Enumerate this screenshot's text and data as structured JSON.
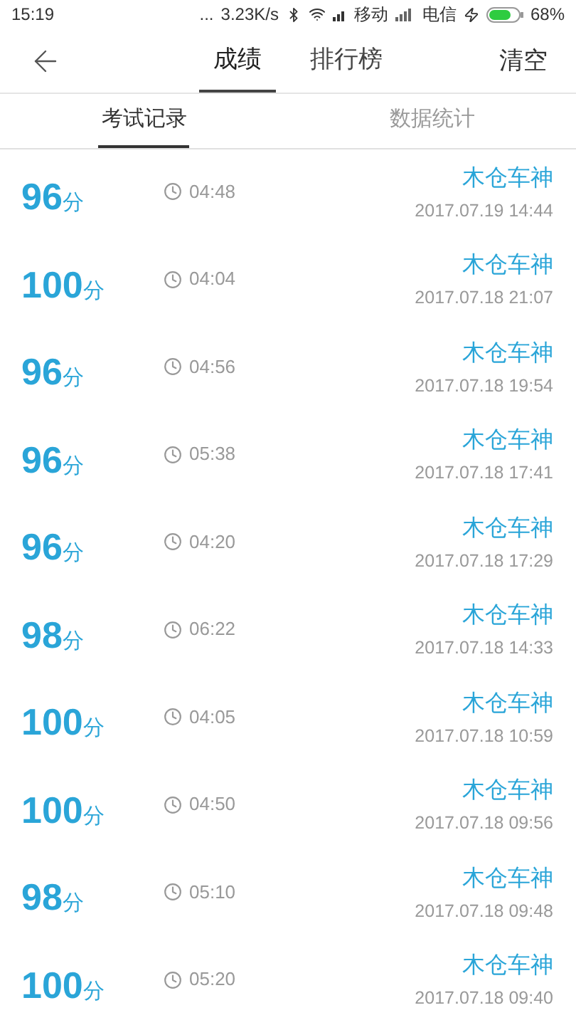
{
  "status_bar": {
    "time": "15:19",
    "dots": "...",
    "speed": "3.23K/s",
    "carrier_1": "移动",
    "carrier_2": "电信",
    "battery": "68%"
  },
  "nav": {
    "tabs": [
      {
        "label": "成绩",
        "selected": true
      },
      {
        "label": "排行榜",
        "selected": false
      }
    ],
    "action": "清空"
  },
  "sub_tabs": [
    {
      "label": "考试记录",
      "selected": true
    },
    {
      "label": "数据统计",
      "selected": false
    }
  ],
  "records": [
    {
      "score": "96",
      "unit": "分",
      "duration": "04:48",
      "name": "木仓车神",
      "datetime": "2017.07.19 14:44"
    },
    {
      "score": "100",
      "unit": "分",
      "duration": "04:04",
      "name": "木仓车神",
      "datetime": "2017.07.18 21:07"
    },
    {
      "score": "96",
      "unit": "分",
      "duration": "04:56",
      "name": "木仓车神",
      "datetime": "2017.07.18 19:54"
    },
    {
      "score": "96",
      "unit": "分",
      "duration": "05:38",
      "name": "木仓车神",
      "datetime": "2017.07.18 17:41"
    },
    {
      "score": "96",
      "unit": "分",
      "duration": "04:20",
      "name": "木仓车神",
      "datetime": "2017.07.18 17:29"
    },
    {
      "score": "98",
      "unit": "分",
      "duration": "06:22",
      "name": "木仓车神",
      "datetime": "2017.07.18 14:33"
    },
    {
      "score": "100",
      "unit": "分",
      "duration": "04:05",
      "name": "木仓车神",
      "datetime": "2017.07.18 10:59"
    },
    {
      "score": "100",
      "unit": "分",
      "duration": "04:50",
      "name": "木仓车神",
      "datetime": "2017.07.18 09:56"
    },
    {
      "score": "98",
      "unit": "分",
      "duration": "05:10",
      "name": "木仓车神",
      "datetime": "2017.07.18 09:48"
    },
    {
      "score": "100",
      "unit": "分",
      "duration": "05:20",
      "name": "木仓车神",
      "datetime": "2017.07.18 09:40"
    }
  ]
}
